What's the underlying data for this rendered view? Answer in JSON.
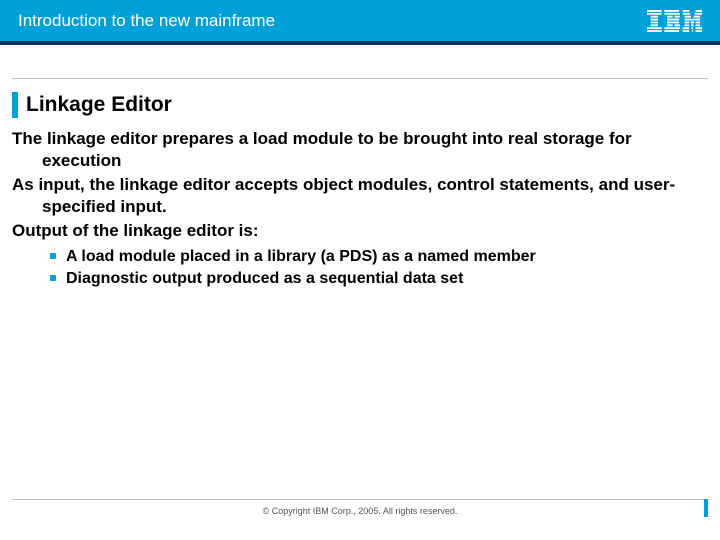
{
  "header": {
    "title": "Introduction to the new mainframe"
  },
  "title": "Linkage Editor",
  "paragraphs": [
    "The linkage editor prepares a load module to be brought into real storage for execution",
    "As input, the linkage editor accepts object modules, control statements, and user-specified input.",
    "Output of the linkage editor is:"
  ],
  "bullets": [
    "A load module placed in a library (a PDS) as a named member",
    "Diagnostic output produced as a sequential data set"
  ],
  "footer": {
    "copyright": "© Copyright IBM Corp., 2005. All rights reserved."
  }
}
